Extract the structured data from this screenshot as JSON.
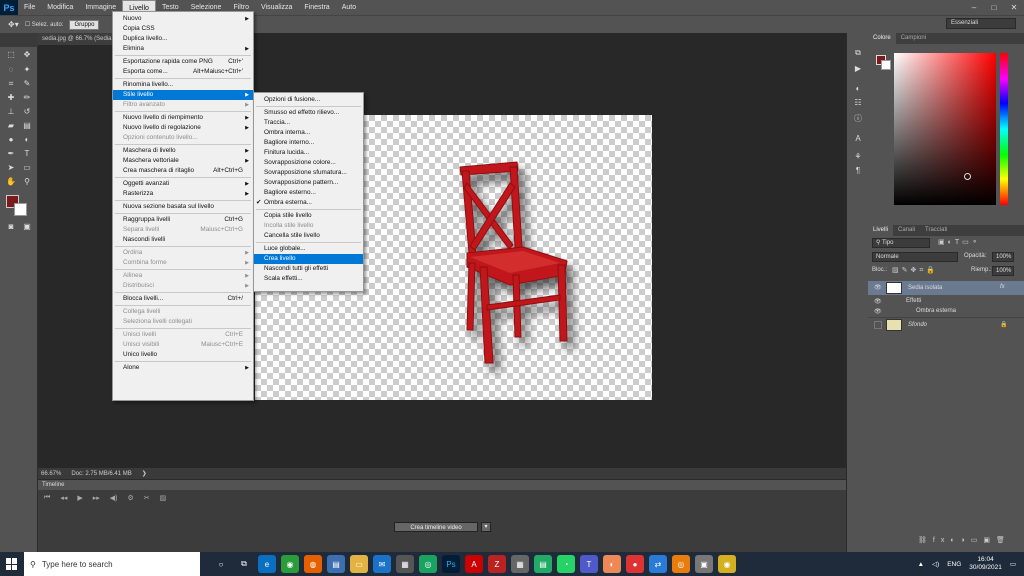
{
  "app": {
    "logo": "Ps",
    "menus": [
      "File",
      "Modifica",
      "Immagine",
      "Livello",
      "Testo",
      "Selezione",
      "Filtro",
      "Visualizza",
      "Finestra",
      "Auto"
    ],
    "active_menu": "Livello"
  },
  "options": {
    "auto_select": "Selez. auto:",
    "group": "Gruppo",
    "workspace": "Essenziali"
  },
  "document": {
    "tab": "sedia.jpg @ 66.7% (Sedia isolata, RGB/8)",
    "zoom": "66.67%",
    "doc_info": "Doc: 2.75 MB/6.41 MB"
  },
  "menu": {
    "items": [
      {
        "label": "Nuovo",
        "arrow": true
      },
      {
        "label": "Copia CSS"
      },
      {
        "label": "Duplica livello..."
      },
      {
        "label": "Elimina",
        "arrow": true
      },
      {
        "sep": true
      },
      {
        "label": "Esportazione rapida come PNG",
        "shortcut": "Ctrl+'"
      },
      {
        "label": "Esporta come...",
        "shortcut": "Alt+Maiusc+Ctrl+'"
      },
      {
        "sep": true
      },
      {
        "label": "Rinomina livello..."
      },
      {
        "label": "Stile livello",
        "arrow": true,
        "highlight": true
      },
      {
        "label": "Filtro avanzato",
        "arrow": true,
        "disabled": true
      },
      {
        "sep": true
      },
      {
        "label": "Nuovo livello di riempimento",
        "arrow": true
      },
      {
        "label": "Nuovo livello di regolazione",
        "arrow": true
      },
      {
        "label": "Opzioni contenuto livello...",
        "disabled": true
      },
      {
        "sep": true
      },
      {
        "label": "Maschera di livello",
        "arrow": true
      },
      {
        "label": "Maschera vettoriale",
        "arrow": true
      },
      {
        "label": "Crea maschera di ritaglio",
        "shortcut": "Alt+Ctrl+G"
      },
      {
        "sep": true
      },
      {
        "label": "Oggetti avanzati",
        "arrow": true
      },
      {
        "label": "Rasterizza",
        "arrow": true
      },
      {
        "sep": true
      },
      {
        "label": "Nuova sezione basata sul livello"
      },
      {
        "sep": true
      },
      {
        "label": "Raggruppa livelli",
        "shortcut": "Ctrl+G"
      },
      {
        "label": "Separa livelli",
        "shortcut": "Maiusc+Ctrl+G",
        "disabled": true
      },
      {
        "label": "Nascondi livelli"
      },
      {
        "sep": true
      },
      {
        "label": "Ordina",
        "arrow": true,
        "disabled": true
      },
      {
        "label": "Combina forme",
        "arrow": true,
        "disabled": true
      },
      {
        "sep": true
      },
      {
        "label": "Allinea",
        "arrow": true,
        "disabled": true
      },
      {
        "label": "Distribuisci",
        "arrow": true,
        "disabled": true
      },
      {
        "sep": true
      },
      {
        "label": "Blocca livelli...",
        "shortcut": "Ctrl+/"
      },
      {
        "sep": true
      },
      {
        "label": "Collega livelli",
        "disabled": true
      },
      {
        "label": "Seleziona livelli collegati",
        "disabled": true
      },
      {
        "sep": true
      },
      {
        "label": "Unisci livelli",
        "shortcut": "Ctrl+E",
        "disabled": true
      },
      {
        "label": "Unisci visibili",
        "shortcut": "Maiusc+Ctrl+E",
        "disabled": true
      },
      {
        "label": "Unico livello"
      },
      {
        "sep": true
      },
      {
        "label": "Alone",
        "arrow": true
      }
    ]
  },
  "submenu": {
    "items": [
      {
        "label": "Opzioni di fusione..."
      },
      {
        "sep": true
      },
      {
        "label": "Smusso ed effetto rilievo..."
      },
      {
        "label": "Traccia..."
      },
      {
        "label": "Ombra interna..."
      },
      {
        "label": "Bagliore interno..."
      },
      {
        "label": "Finitura lucida..."
      },
      {
        "label": "Sovrapposizione colore..."
      },
      {
        "label": "Sovrapposizione sfumatura..."
      },
      {
        "label": "Sovrapposizione pattern..."
      },
      {
        "label": "Bagliore esterno..."
      },
      {
        "label": "Ombra esterna...",
        "checked": true
      },
      {
        "sep": true
      },
      {
        "label": "Copia stile livello"
      },
      {
        "label": "Incolla stile livello",
        "disabled": true
      },
      {
        "label": "Cancella stile livello"
      },
      {
        "sep": true
      },
      {
        "label": "Luce globale..."
      },
      {
        "label": "Crea livello",
        "highlight": true
      },
      {
        "label": "Nascondi tutti gli effetti"
      },
      {
        "label": "Scala effetti..."
      }
    ]
  },
  "timeline": {
    "title": "Timeline",
    "create_button": "Crea timeline video"
  },
  "color_panel": {
    "tabs": [
      "Colore",
      "Campioni"
    ],
    "foreground": "#7b1a1a",
    "background": "#ffffff"
  },
  "layers_panel": {
    "tabs": [
      "Livelli",
      "Canali",
      "Tracciati"
    ],
    "filter": "Tipo",
    "blend_mode": "Normale",
    "opacity_label": "Opacità:",
    "opacity": "100%",
    "lock_label": "Bloc.:",
    "fill_label": "Riemp.:",
    "fill": "100%",
    "layers": [
      {
        "name": "Sedia isolata",
        "fx": "fx"
      },
      {
        "name": "Effetti"
      },
      {
        "name": "Ombra esterna"
      },
      {
        "name": "Sfondo"
      }
    ]
  },
  "taskbar": {
    "search_placeholder": "Type here to search",
    "lang": "ENG",
    "time": "16:04",
    "date": "30/09/2021"
  }
}
